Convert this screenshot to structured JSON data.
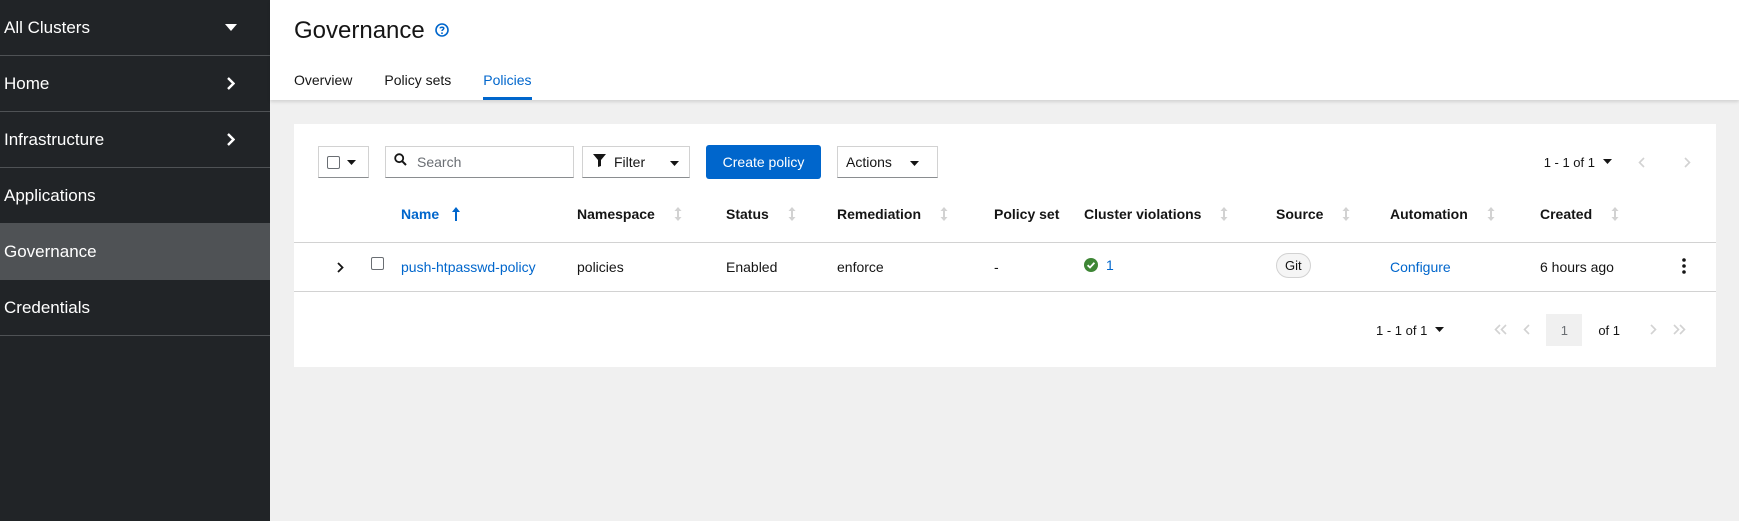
{
  "sidebar": {
    "cluster_switcher": "All Clusters",
    "items": [
      {
        "label": "Home"
      },
      {
        "label": "Infrastructure"
      },
      {
        "label": "Applications"
      },
      {
        "label": "Governance"
      },
      {
        "label": "Credentials"
      }
    ],
    "active": "Governance"
  },
  "header": {
    "title": "Governance",
    "tabs": [
      {
        "label": "Overview"
      },
      {
        "label": "Policy sets"
      },
      {
        "label": "Policies"
      }
    ],
    "active_tab": "Policies"
  },
  "toolbar": {
    "search_placeholder": "Search",
    "filter_label": "Filter",
    "create_label": "Create policy",
    "actions_label": "Actions"
  },
  "pagination_top": {
    "range": "1 - 1 of 1"
  },
  "table": {
    "columns": [
      "Name",
      "Namespace",
      "Status",
      "Remediation",
      "Policy set",
      "Cluster violations",
      "Source",
      "Automation",
      "Created"
    ],
    "rows": [
      {
        "name": "push-htpasswd-policy",
        "namespace": "policies",
        "status": "Enabled",
        "remediation": "enforce",
        "policy_set": "-",
        "cluster_violations": "1",
        "source": "Git",
        "automation": "Configure",
        "created": "6 hours ago"
      }
    ]
  },
  "pagination_bottom": {
    "range": "1 - 1 of 1",
    "current_page": "1",
    "of_pages": "of 1"
  },
  "colors": {
    "accent": "#0066cc",
    "sidebar_bg": "#212427",
    "success": "#3e8635"
  }
}
